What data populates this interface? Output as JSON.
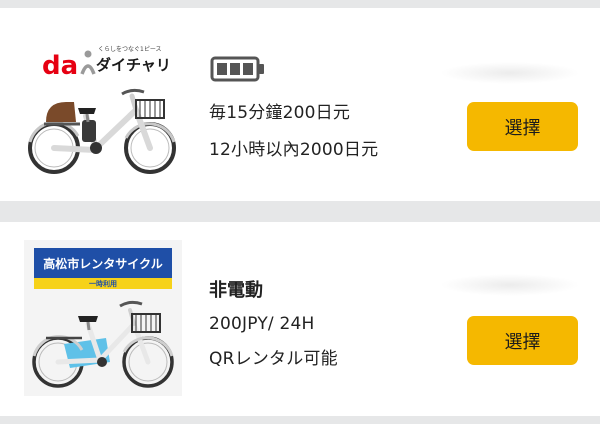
{
  "offers": [
    {
      "brand": {
        "logo_letters": "da",
        "tagline": "くらしをつなぐ1ピース",
        "name": "ダイチャリ"
      },
      "battery_icon": "battery-full-icon",
      "price_line_1": "毎15分鐘200日元",
      "price_line_2": "12小時以內2000日元",
      "select_label": "選擇"
    },
    {
      "banner": {
        "title": "高松市レンタサイクル",
        "subtitle": "一時利用"
      },
      "type_label": "非電動",
      "price_line_1": "200JPY/ 24H",
      "price_line_2": "QRレンタル可能",
      "select_label": "選擇"
    }
  ],
  "colors": {
    "button": "#f5b800",
    "background": "#e6e7e8",
    "card": "#ffffff",
    "brand_red": "#e60012",
    "city_blue": "#1f4fa7",
    "city_yellow": "#f6d21a",
    "frame_blue": "#5fc1e8"
  }
}
